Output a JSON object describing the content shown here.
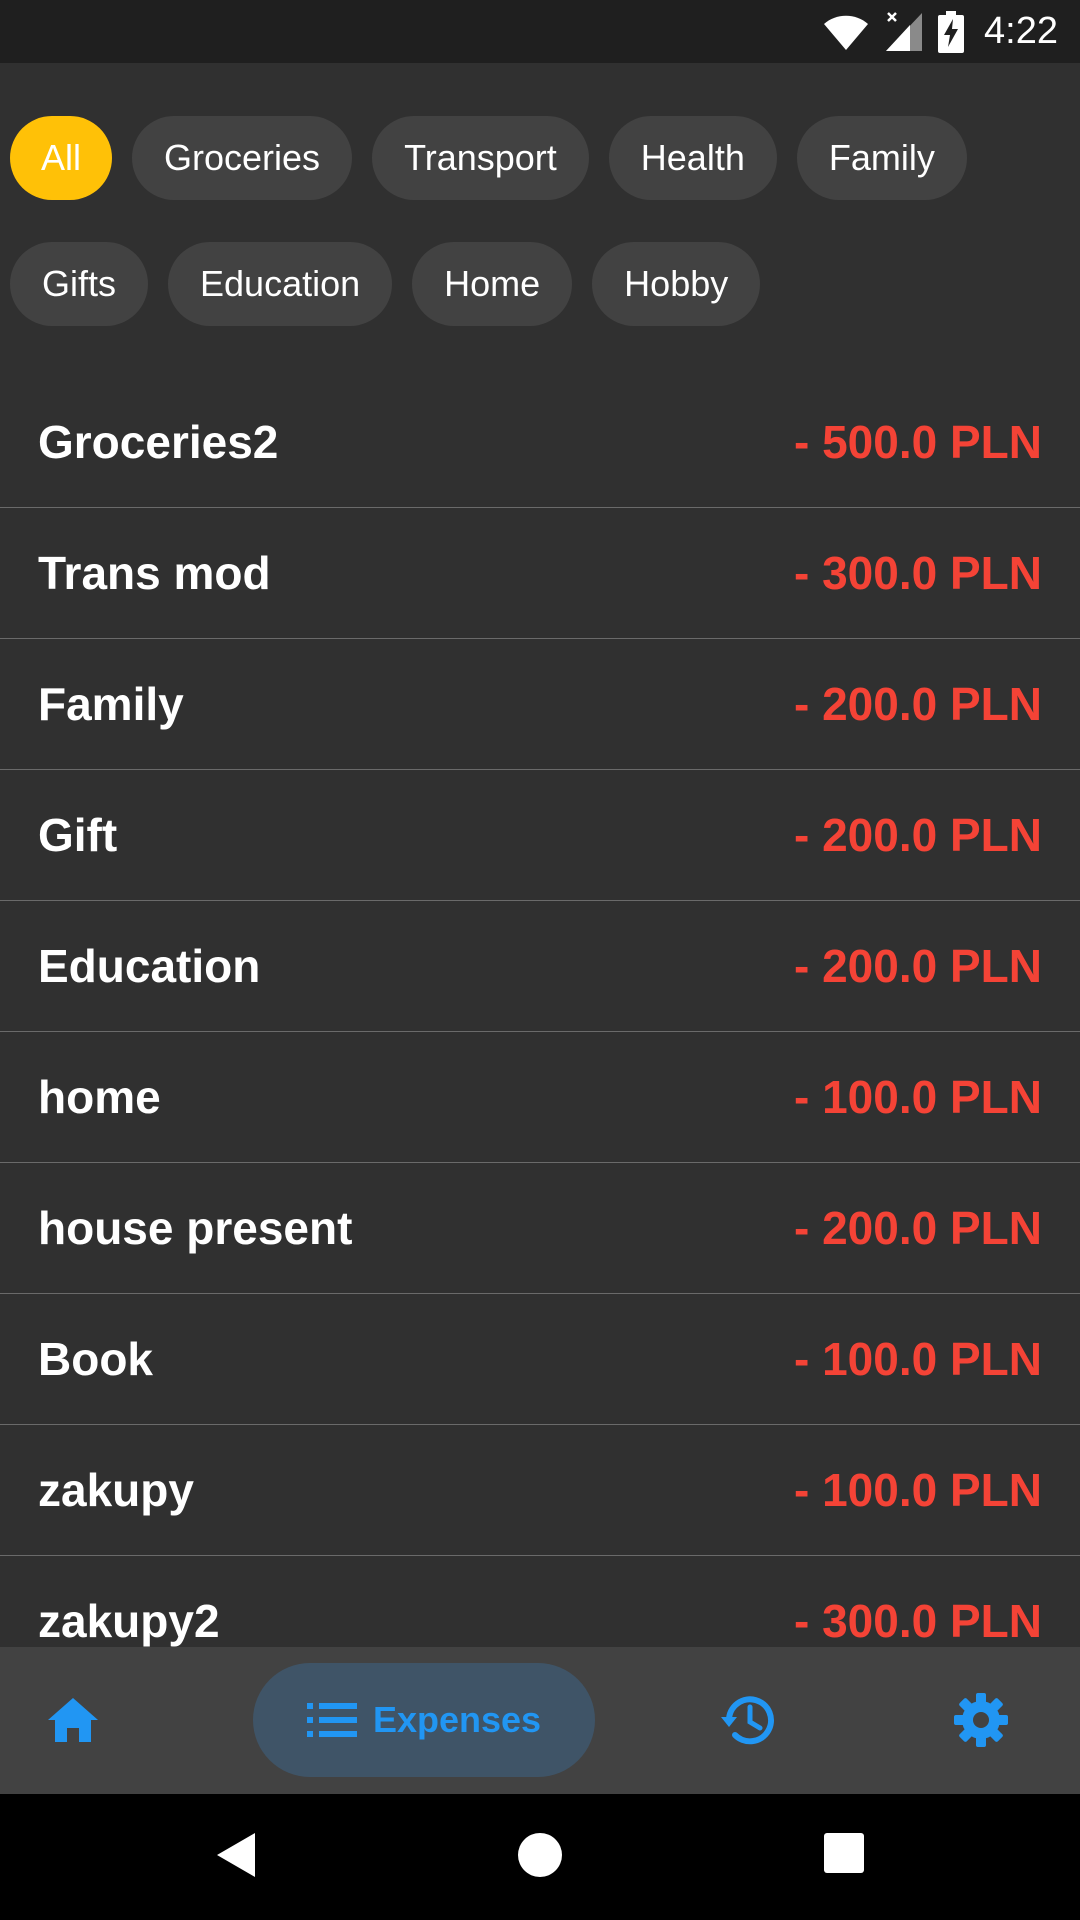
{
  "status_bar": {
    "time": "4:22",
    "icons": [
      "wifi-icon",
      "signal-icon",
      "battery-charging-icon"
    ]
  },
  "filters": {
    "row1": [
      "All",
      "Groceries",
      "Transport",
      "Health",
      "Family"
    ],
    "row2": [
      "Gifts",
      "Education",
      "Home",
      "Hobby"
    ],
    "selected": "All",
    "selected_color": "#FFC107"
  },
  "expenses": [
    {
      "name": "Groceries2",
      "amount": "- 500.0 PLN"
    },
    {
      "name": "Trans mod",
      "amount": "- 300.0 PLN"
    },
    {
      "name": "Family",
      "amount": "- 200.0 PLN"
    },
    {
      "name": "Gift",
      "amount": "- 200.0 PLN"
    },
    {
      "name": "Education",
      "amount": "- 200.0 PLN"
    },
    {
      "name": "home",
      "amount": "- 100.0 PLN"
    },
    {
      "name": "house present",
      "amount": "- 200.0 PLN"
    },
    {
      "name": "Book",
      "amount": "- 100.0 PLN"
    },
    {
      "name": "zakupy",
      "amount": "- 100.0 PLN"
    },
    {
      "name": "zakupy2",
      "amount": "- 300.0 PLN"
    }
  ],
  "amount_color": "#F44336",
  "bottom_nav": {
    "items": [
      "home-icon",
      "list-icon",
      "history-icon",
      "settings-icon"
    ],
    "active_label": "Expenses",
    "accent": "#2196F3"
  },
  "system_nav": [
    "back-icon",
    "home-circle-icon",
    "recents-icon"
  ]
}
